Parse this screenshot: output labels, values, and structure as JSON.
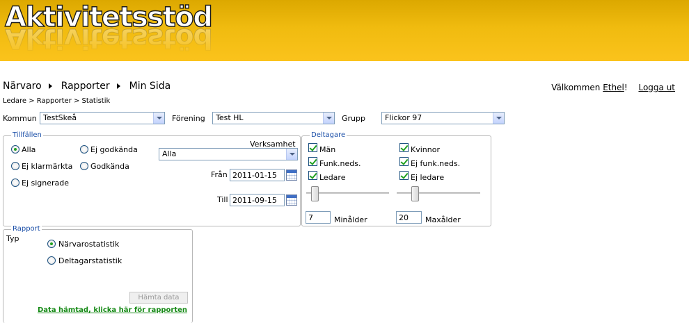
{
  "app": {
    "title": "Aktivitetsstöd"
  },
  "nav": {
    "items": [
      "Närvaro",
      "Rapporter",
      "Min Sida"
    ]
  },
  "welcome": {
    "prefix": "Välkommen ",
    "user": "Ethel",
    "suffix": "!",
    "logout": "Logga ut"
  },
  "breadcrumb": "Ledare > Rapporter > Statistik",
  "filters": {
    "kommun_label": "Kommun",
    "kommun_value": "TestSkeå",
    "forening_label": "Förening",
    "forening_value": "Test HL",
    "grupp_label": "Grupp",
    "grupp_value": "Flickor 97"
  },
  "tillfallen": {
    "legend": "Tillfällen",
    "options": [
      {
        "label": "Alla",
        "checked": true
      },
      {
        "label": "Ej godkända",
        "checked": false
      },
      {
        "label": "Ej klarmärkta",
        "checked": false
      },
      {
        "label": "Godkända",
        "checked": false
      },
      {
        "label": "Ej signerade",
        "checked": false
      }
    ],
    "verksamhet_label": "Verksamhet",
    "verksamhet_value": "Alla",
    "fran_label": "Från",
    "fran_value": "2011-01-15",
    "till_label": "Till",
    "till_value": "2011-09-15"
  },
  "deltagare": {
    "legend": "Deltagare",
    "checkboxes": [
      {
        "label": "Män",
        "checked": true
      },
      {
        "label": "Kvinnor",
        "checked": true
      },
      {
        "label": "Funk.neds.",
        "checked": true
      },
      {
        "label": "Ej funk.neds.",
        "checked": true
      },
      {
        "label": "Ledare",
        "checked": true
      },
      {
        "label": "Ej ledare",
        "checked": true
      }
    ],
    "min_age_value": "7",
    "min_age_label": "Minålder",
    "max_age_value": "20",
    "max_age_label": "Maxålder"
  },
  "rapport": {
    "legend": "Rapport",
    "typ_label": "Typ",
    "options": [
      {
        "label": "Närvarostatistik",
        "checked": true
      },
      {
        "label": "Deltagarstatistik",
        "checked": false
      }
    ],
    "fetch_button": "Hämta data",
    "result_link": "Data hämtad, klicka här för rapporten"
  }
}
